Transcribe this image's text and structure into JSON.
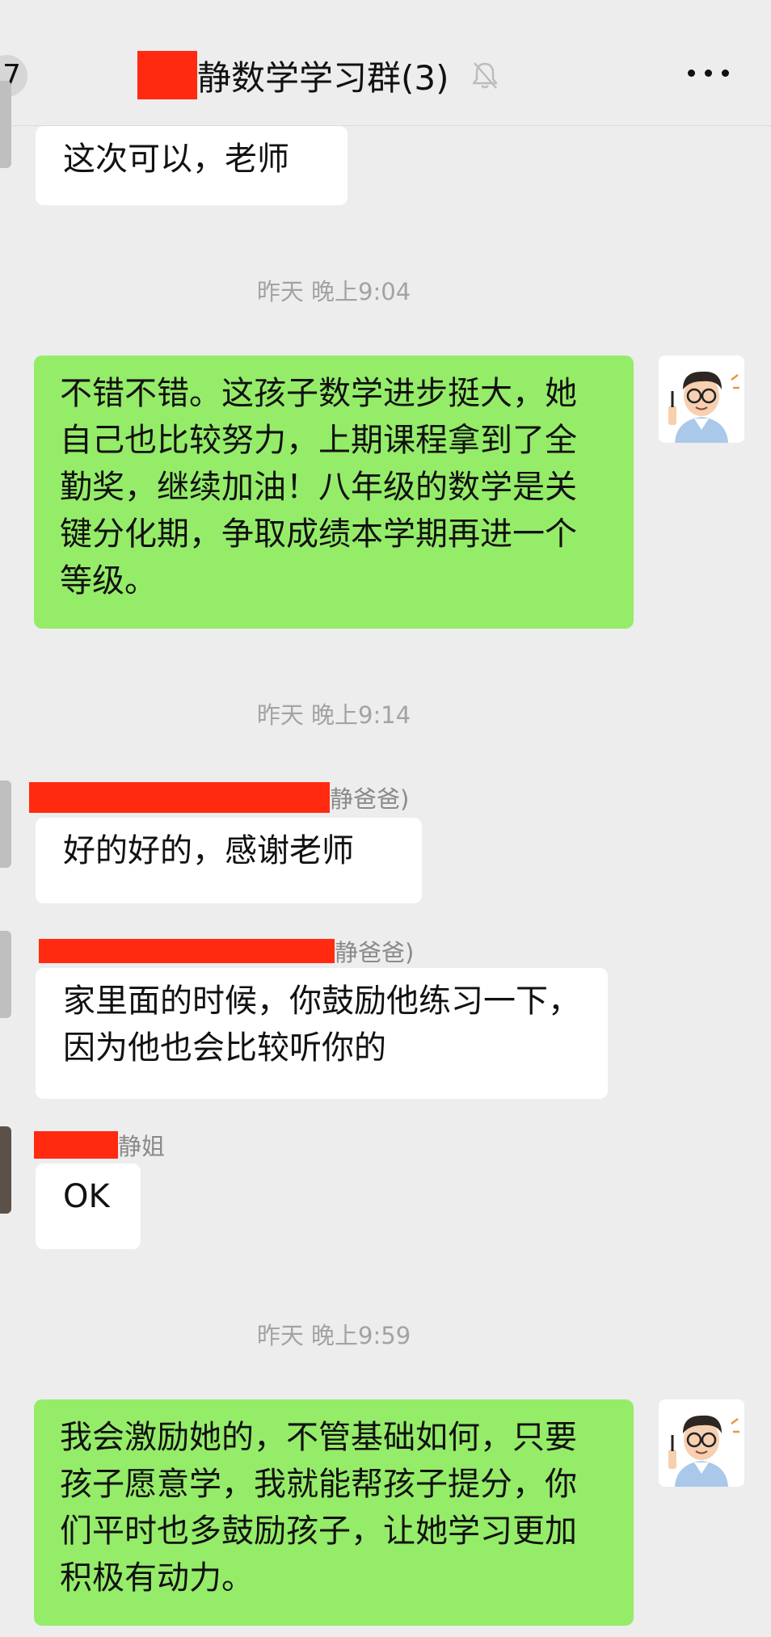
{
  "header": {
    "back_count": "7",
    "title": "静数学学习群(3)"
  },
  "colors": {
    "background": "#ededed",
    "outgoing_bubble": "#95ec69",
    "incoming_bubble": "#ffffff",
    "redaction": "#ff2a10"
  },
  "messages": [
    {
      "type": "incoming",
      "text": "这次可以，老师"
    },
    {
      "type": "time",
      "text": "昨天 晚上9:04"
    },
    {
      "type": "outgoing",
      "text": "不错不错。这孩子数学进步挺大，她自己也比较努力，上期课程拿到了全勤奖，继续加油！八年级的数学是关键分化期，争取成绩本学期再进一个等级。"
    },
    {
      "type": "time",
      "text": "昨天 晚上9:14"
    },
    {
      "type": "incoming",
      "sender": "静爸爸)",
      "text": "好的好的，感谢老师"
    },
    {
      "type": "incoming",
      "sender": "静爸爸)",
      "text": "家里面的时候，你鼓励他练习一下，因为他也会比较听你的"
    },
    {
      "type": "incoming",
      "sender": "静姐",
      "text": "OK"
    },
    {
      "type": "time",
      "text": "昨天 晚上9:59"
    },
    {
      "type": "outgoing",
      "text": "我会激励她的，不管基础如何，只要孩子愿意学，我就能帮孩子提分，你们平时也多鼓励孩子，让她学习更加积极有动力。"
    }
  ]
}
